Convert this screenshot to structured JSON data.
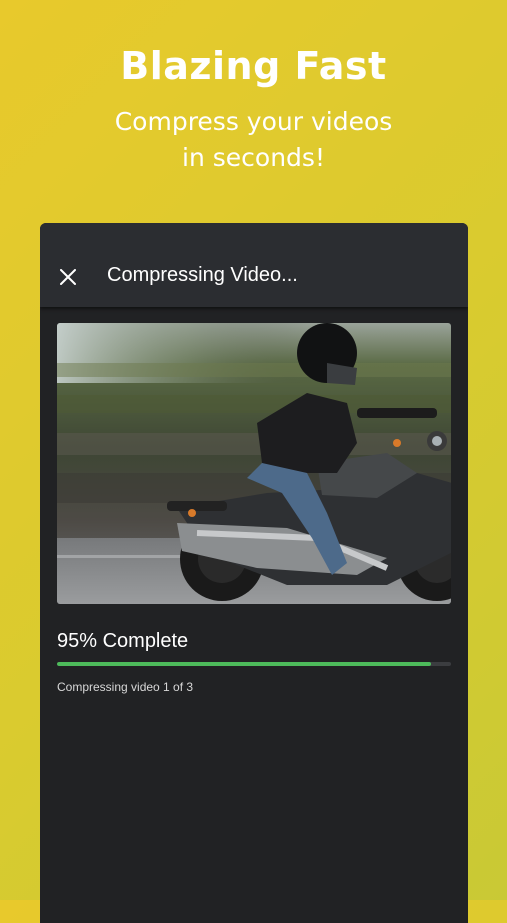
{
  "promo": {
    "headline": "Blazing Fast",
    "subhead_line1": "Compress your videos",
    "subhead_line2": "in seconds!"
  },
  "appbar": {
    "close_icon": "close-icon",
    "title": "Compressing Video..."
  },
  "video": {
    "subject": "motorcycle-rider-thumbnail"
  },
  "progress": {
    "label": "95% Complete",
    "fraction": 0.95,
    "status": "Compressing video 1 of 3"
  },
  "colors": {
    "background": "#e3c930",
    "panel": "#212224",
    "appbar": "#2b2d31",
    "progress": "#4dbb5b"
  }
}
